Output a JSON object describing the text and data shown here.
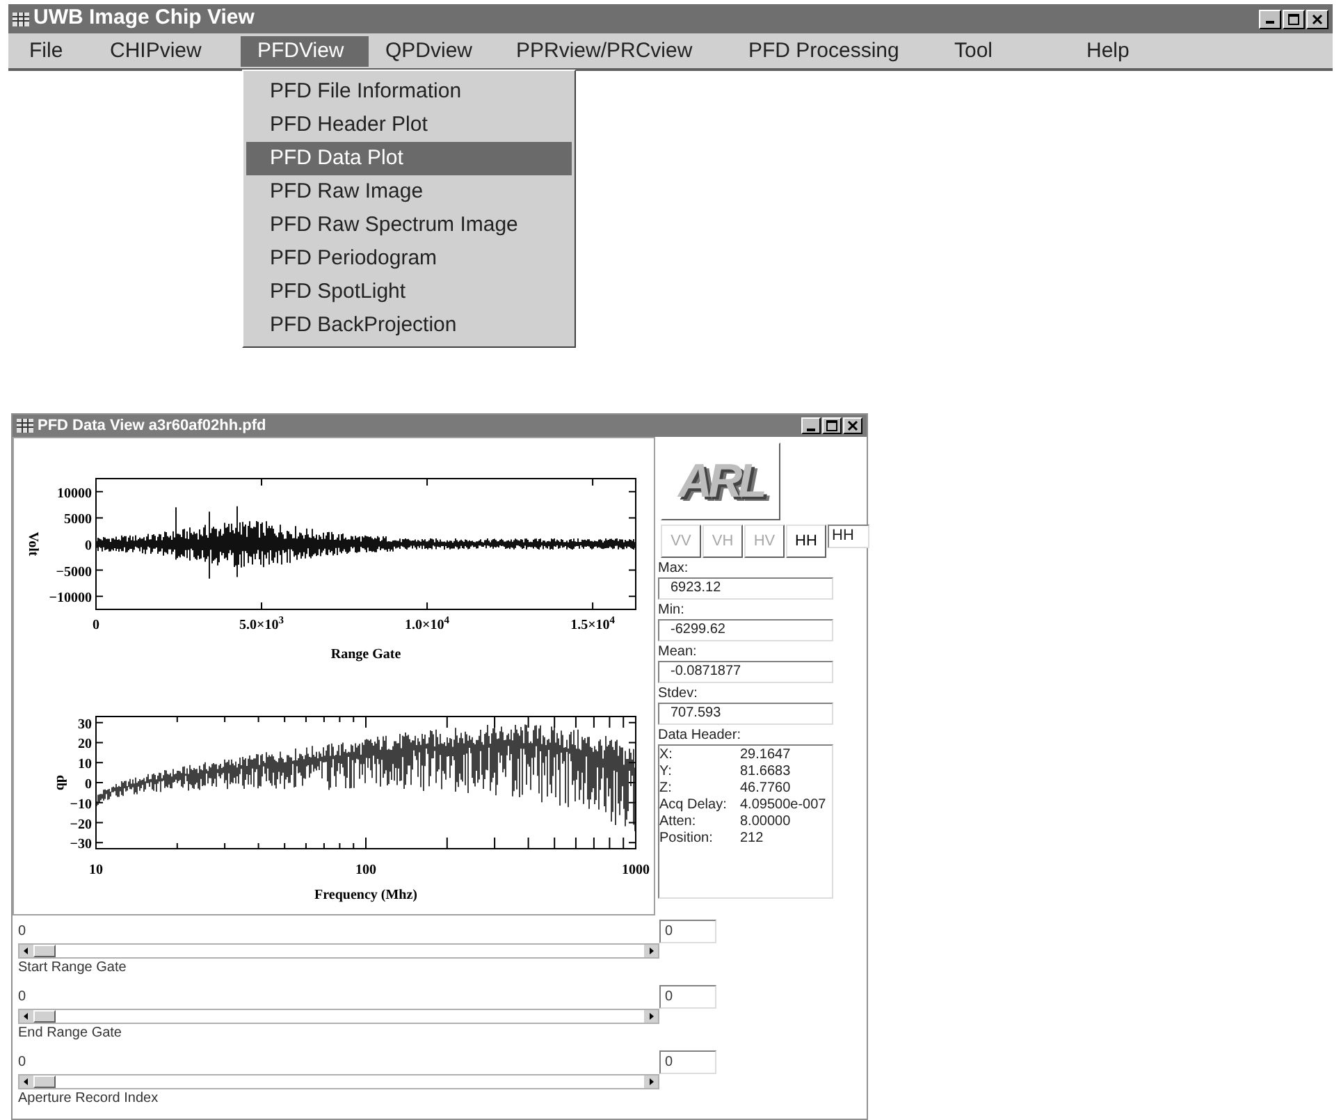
{
  "window": {
    "title": "UWB Image Chip View"
  },
  "menu": [
    {
      "label": "File",
      "selected": false
    },
    {
      "label": "CHIPview",
      "selected": false
    },
    {
      "label": "PFDView",
      "selected": true
    },
    {
      "label": "QPDview",
      "selected": false
    },
    {
      "label": "PPRview/PRCview",
      "selected": false
    },
    {
      "label": "PFD Processing",
      "selected": false
    },
    {
      "label": "Tool",
      "selected": false
    },
    {
      "label": "Help",
      "selected": false
    }
  ],
  "dropdown": [
    {
      "label": "PFD File Information",
      "selected": false
    },
    {
      "label": "PFD Header Plot",
      "selected": false
    },
    {
      "label": "PFD Data Plot",
      "selected": true
    },
    {
      "label": "PFD Raw Image",
      "selected": false
    },
    {
      "label": "PFD Raw Spectrum Image",
      "selected": false
    },
    {
      "label": "PFD Periodogram",
      "selected": false
    },
    {
      "label": "PFD SpotLight",
      "selected": false
    },
    {
      "label": "PFD BackProjection",
      "selected": false
    }
  ],
  "data_window": {
    "title": "PFD Data View a3r60af02hh.pfd",
    "time_plot": {
      "ylabel": "Volt",
      "xlabel": "Range Gate",
      "yticks": [
        "10000",
        "5000",
        "0",
        "−5000",
        "−10000"
      ],
      "xticks": [
        "0",
        "5.0×10$^{3}$",
        "1.0×10$^{4}$",
        "1.5×10$^{4}$"
      ]
    },
    "spectrum_plot": {
      "ylabel": "db",
      "xlabel": "Frequency (Mhz)",
      "yticks": [
        "30",
        "20",
        "10",
        "0",
        "−10",
        "−20",
        "−30"
      ],
      "xticks": [
        "10",
        "100",
        "1000"
      ]
    },
    "logo": {
      "text": "ARL"
    },
    "polarization": [
      {
        "label": "VV",
        "disabled": true
      },
      {
        "label": "VH",
        "disabled": true
      },
      {
        "label": "HV",
        "disabled": true
      },
      {
        "label": "HH",
        "disabled": false
      }
    ],
    "polarization_field": "HH",
    "stats": [
      {
        "label": "Max:",
        "value": "6923.12"
      },
      {
        "label": "Min:",
        "value": "-6299.62"
      },
      {
        "label": "Mean:",
        "value": "-0.0871877"
      },
      {
        "label": "Stdev:",
        "value": "707.593"
      }
    ],
    "data_header": {
      "label": "Data Header:",
      "rows": [
        {
          "name": "X:",
          "value": "29.1647"
        },
        {
          "name": "Y:",
          "value": "81.6683"
        },
        {
          "name": "Z:",
          "value": "46.7760"
        },
        {
          "name": "Acq Delay:",
          "value": "4.09500e-007"
        },
        {
          "name": "Atten:",
          "value": "8.00000"
        },
        {
          "name": "Position:",
          "value": "212"
        }
      ]
    },
    "sliders": [
      {
        "value_label": "0",
        "label": "Start Range Gate",
        "field": "0",
        "level": 0
      },
      {
        "value_label": "0",
        "label": "End Range Gate",
        "field": "0",
        "level": 0
      },
      {
        "value_label": "0",
        "label": "Aperture Record Index",
        "field": "0",
        "level": 0
      }
    ]
  }
}
